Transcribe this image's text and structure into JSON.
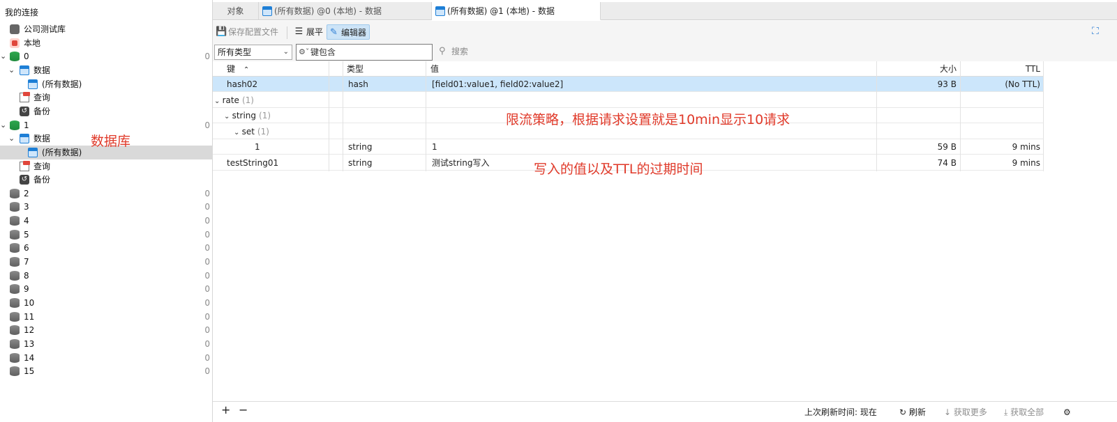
{
  "sidebar": {
    "title": "我的连接",
    "items": [
      {
        "label": "公司测试库",
        "type": "company",
        "count": ""
      },
      {
        "label": "本地",
        "type": "server",
        "count": ""
      },
      {
        "label": "0",
        "type": "db-green",
        "count": "0",
        "expanded": true
      },
      {
        "label": "数据",
        "type": "table-group"
      },
      {
        "label": "(所有数据)",
        "type": "table"
      },
      {
        "label": "查询",
        "type": "query"
      },
      {
        "label": "备份",
        "type": "backup"
      },
      {
        "label": "1",
        "type": "db-green",
        "count": "0",
        "expanded": true
      },
      {
        "label": "数据",
        "type": "table-group"
      },
      {
        "label": "(所有数据)",
        "type": "table",
        "selected": true
      },
      {
        "label": "查询",
        "type": "query"
      },
      {
        "label": "备份",
        "type": "backup"
      },
      {
        "label": "2",
        "type": "db-gray",
        "count": "0"
      },
      {
        "label": "3",
        "type": "db-gray",
        "count": "0"
      },
      {
        "label": "4",
        "type": "db-gray",
        "count": "0"
      },
      {
        "label": "5",
        "type": "db-gray",
        "count": "0"
      },
      {
        "label": "6",
        "type": "db-gray",
        "count": "0"
      },
      {
        "label": "7",
        "type": "db-gray",
        "count": "0"
      },
      {
        "label": "8",
        "type": "db-gray",
        "count": "0"
      },
      {
        "label": "9",
        "type": "db-gray",
        "count": "0"
      },
      {
        "label": "10",
        "type": "db-gray",
        "count": "0"
      },
      {
        "label": "11",
        "type": "db-gray",
        "count": "0"
      },
      {
        "label": "12",
        "type": "db-gray",
        "count": "0"
      },
      {
        "label": "13",
        "type": "db-gray",
        "count": "0"
      },
      {
        "label": "14",
        "type": "db-gray",
        "count": "0"
      },
      {
        "label": "15",
        "type": "db-gray",
        "count": "0"
      }
    ]
  },
  "annotations": {
    "database": "数据库",
    "rate_limit": "限流策略，根据请求设置就是10min显示10请求",
    "written_value": "写入的值以及TTL的过期时间"
  },
  "tabs": [
    {
      "label": "对象"
    },
    {
      "label": "(所有数据) @0 (本地) - 数据"
    },
    {
      "label": "(所有数据) @1 (本地) - 数据",
      "active": true
    }
  ],
  "toolbar": {
    "save_config": "保存配置文件",
    "flat": "展平",
    "editor": "编辑器"
  },
  "filter": {
    "type_select": "所有类型",
    "key_filter": "键包含",
    "search": "搜索"
  },
  "table": {
    "headers": {
      "key": "键",
      "type": "类型",
      "value": "值",
      "size": "大小",
      "ttl": "TTL"
    },
    "rows": [
      {
        "key": "hash02",
        "count": "",
        "type": "hash",
        "value": "[field01:value1, field02:value2]",
        "size": "93 B",
        "ttl": "(No TTL)",
        "ttl_muted": true,
        "selected": true,
        "level": 0,
        "group": false
      },
      {
        "key": "rate",
        "count": "(1)",
        "type": "",
        "value": "",
        "size": "",
        "ttl": "",
        "level": 0,
        "group": true
      },
      {
        "key": "string",
        "count": "(1)",
        "type": "",
        "value": "",
        "size": "",
        "ttl": "",
        "level": 1,
        "group": true
      },
      {
        "key": "set",
        "count": "(1)",
        "type": "",
        "value": "",
        "size": "",
        "ttl": "",
        "level": 2,
        "group": true
      },
      {
        "key": "1",
        "count": "",
        "type": "string",
        "value": "1",
        "size": "59 B",
        "ttl": "9 mins",
        "level": 3,
        "group": false
      },
      {
        "key": "testString01",
        "count": "",
        "type": "string",
        "value": "测试string写入",
        "size": "74 B",
        "ttl": "9 mins",
        "level": 0,
        "group": false
      }
    ]
  },
  "statusbar": {
    "add": "+",
    "remove": "−",
    "last_refresh": "上次刷新时间: 现在",
    "refresh": "刷新",
    "load_more": "获取更多",
    "load_all": "获取全部"
  }
}
